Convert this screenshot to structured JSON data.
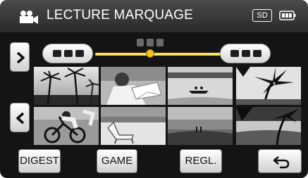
{
  "header": {
    "title": "LECTURE MARQUAGE",
    "camera_icon": "movie-camera-icon",
    "storage_label": "SD",
    "battery_icon": "battery-icon"
  },
  "navigation": {
    "next_icon": "chevron-right-icon",
    "prev_icon": "chevron-left-icon"
  },
  "timeline": {
    "left_marker_icon": "marker-pill-icon",
    "right_marker_icon": "marker-pill-icon",
    "current_page_icon": "page-indicator-icon",
    "position_fraction": 0.44
  },
  "thumbnails": [
    {
      "name": "thumbnail-palm-trees"
    },
    {
      "name": "thumbnail-person-reading"
    },
    {
      "name": "thumbnail-lake-boat"
    },
    {
      "name": "thumbnail-palm-silhouette"
    },
    {
      "name": "thumbnail-cyclist"
    },
    {
      "name": "thumbnail-beach-chair"
    },
    {
      "name": "thumbnail-beach-sunset"
    },
    {
      "name": "thumbnail-palm-shore"
    }
  ],
  "buttons": {
    "digest": "DIGEST",
    "game": "GAME",
    "settings": "REGL.",
    "back_icon": "return-arrow-icon"
  },
  "colors": {
    "slider_track": "#ffe26a",
    "slider_knob": "#f2c21e",
    "background": "#141414"
  }
}
